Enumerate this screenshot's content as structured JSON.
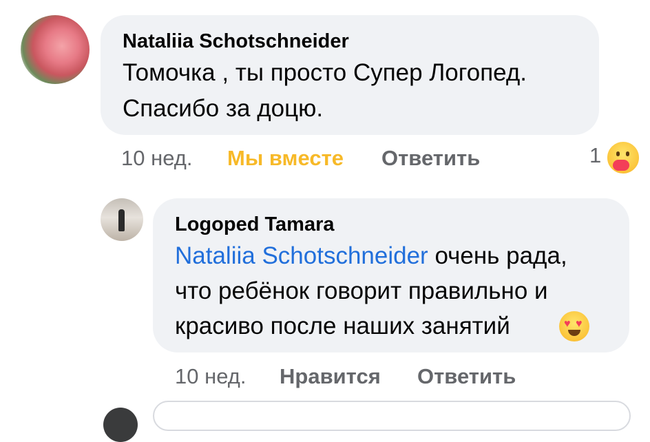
{
  "comment1": {
    "author": "Nataliia Schotschneider",
    "text_line1": "Томочка , ты просто Супер Логопед.",
    "text_line2": "Спасибо за доцю.",
    "time": "10 нед.",
    "reaction_label": "Мы вместе",
    "reply_label": "Ответить",
    "reaction_count": "1",
    "reaction_icon": "care-emoji-icon"
  },
  "reply1": {
    "author": "Logoped Tamara",
    "mention": "Nataliia Schotschneider",
    "text_line1_rest": " очень рада,",
    "text_line2": "что ребёнок говорит правильно и",
    "text_line3": "красиво после наших занятий",
    "emoji": "heart-eyes-emoji-icon",
    "time": "10 нед.",
    "like_label": "Нравится",
    "reply_label": "Ответить"
  },
  "colors": {
    "bubble": "#f0f2f5",
    "mention": "#216fdb",
    "reaction_active": "#f7b928",
    "meta": "#65676b"
  }
}
